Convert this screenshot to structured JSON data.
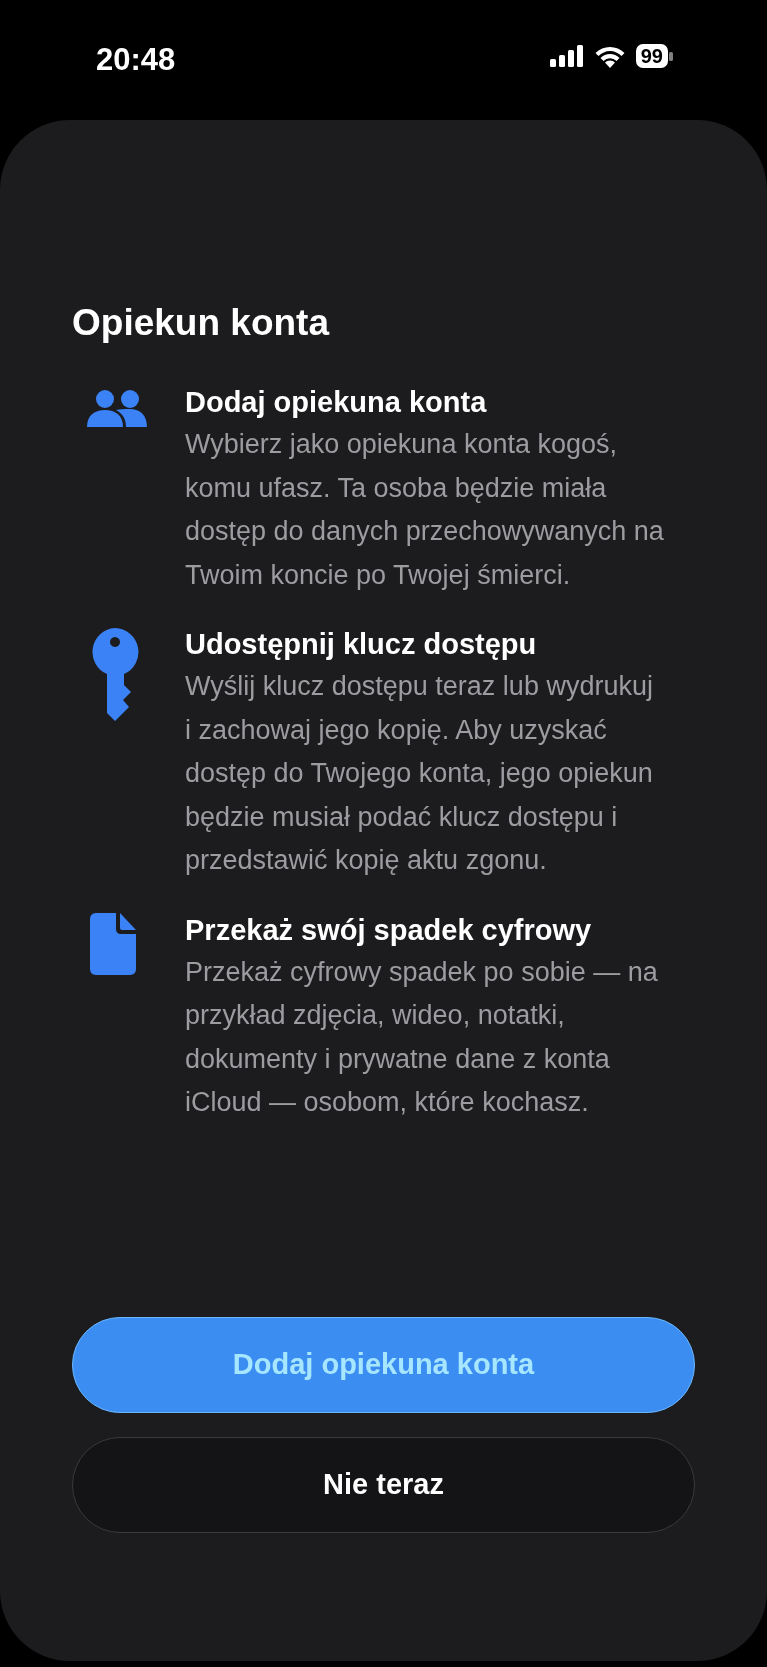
{
  "status_bar": {
    "time": "20:48",
    "battery": "99"
  },
  "title": "Opiekun konta",
  "features": [
    {
      "kind": "people",
      "heading": "Dodaj opiekuna konta",
      "body": "Wybierz jako opiekuna konta kogoś, komu ufasz. Ta osoba będzie miała dostęp do danych przechowywanych na Twoim koncie po Twojej śmierci."
    },
    {
      "kind": "key",
      "heading": "Udostępnij klucz dostępu",
      "body": "Wyślij klucz dostępu teraz lub wydrukuj i zachowaj jego kopię. Aby uzyskać dostęp do Twojego konta, jego opiekun będzie musiał podać klucz dostępu i przedstawić kopię aktu zgonu."
    },
    {
      "kind": "document",
      "heading": "Przekaż swój spadek cyfrowy",
      "body": "Przekaż cyfrowy spadek po sobie — na przykład zdjęcia, wideo, notatki, dokumenty i prywatne dane z konta iCloud — osobom, które kochasz."
    }
  ],
  "primary_button": "Dodaj opiekuna konta",
  "secondary_button": "Nie teraz"
}
